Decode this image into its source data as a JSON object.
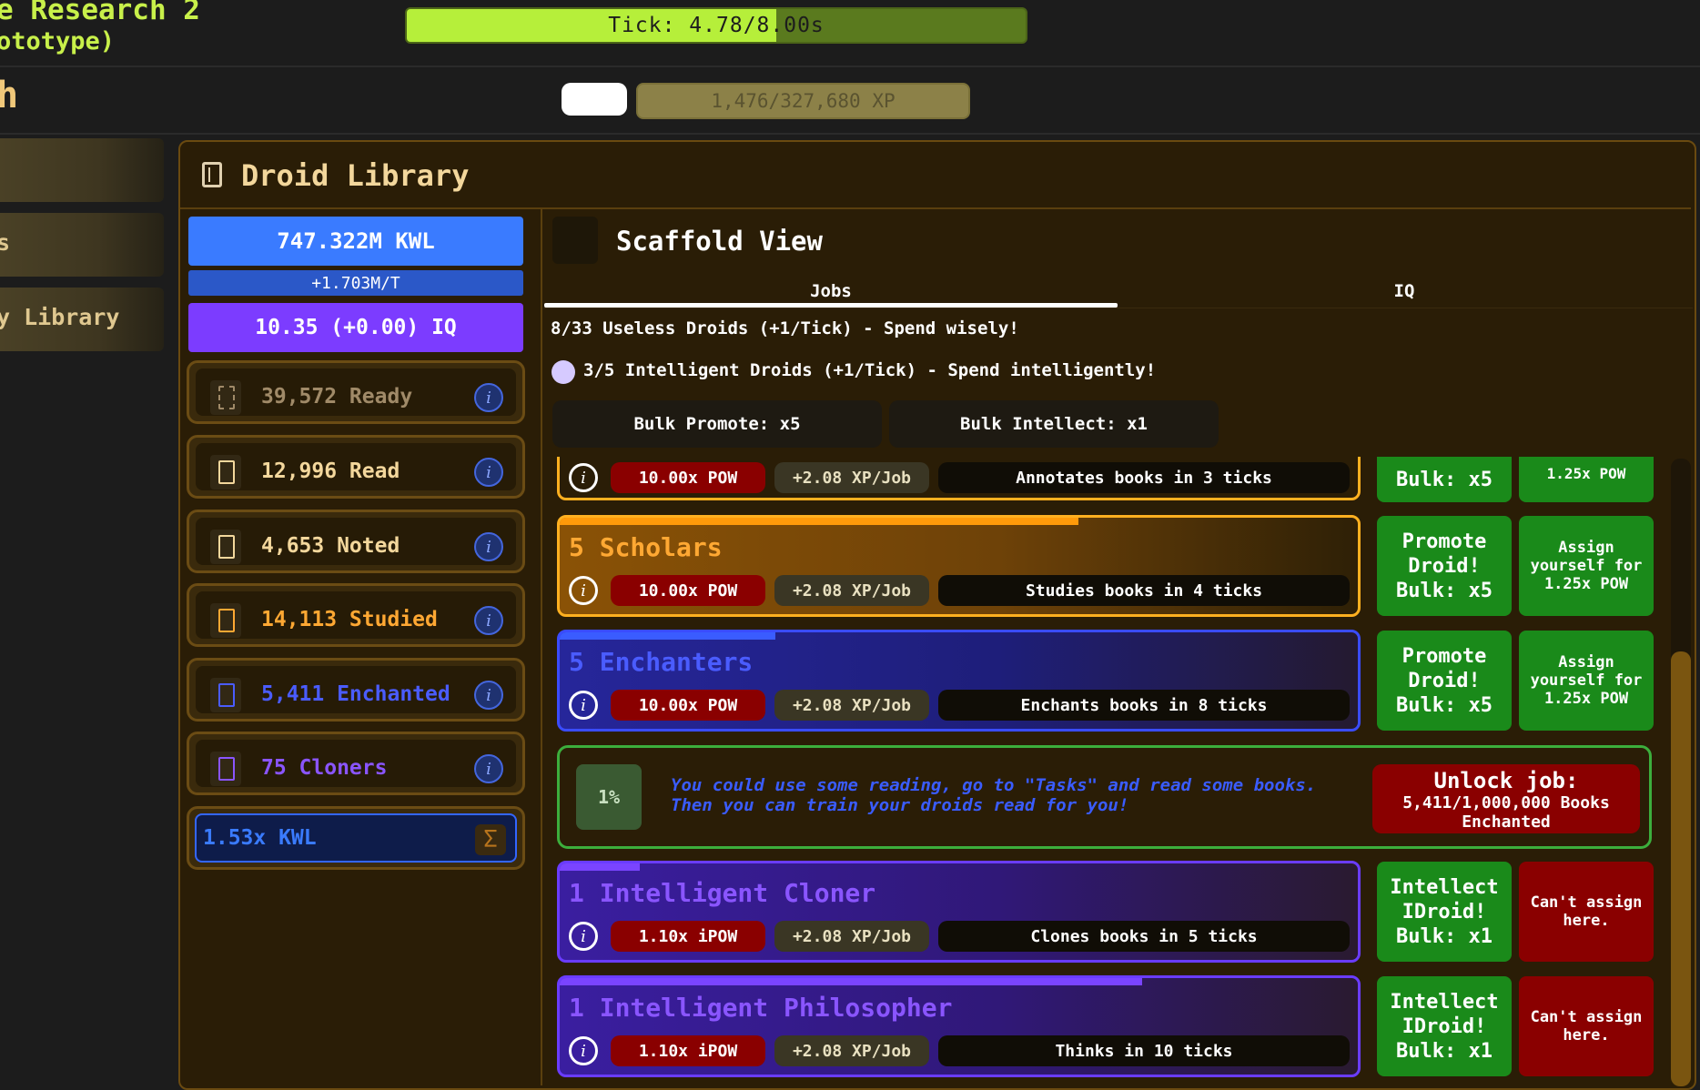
{
  "header": {
    "title": "e Research 2",
    "subtitle": "ototype)",
    "tick_text": "Tick: 4.78/8.00s",
    "tick_progress": 0.5975,
    "section_letter": "h",
    "xp_text": "1,476/327,680 XP"
  },
  "nav": {
    "items": [
      {
        "label": ""
      },
      {
        "label": "s"
      },
      {
        "label": "y Library"
      }
    ]
  },
  "library": {
    "title": "Droid Library",
    "kwl": "747.322M KWL",
    "kwl_rate": "+1.703M/T",
    "iq": "10.35 (+0.00) IQ",
    "resources": [
      {
        "label": "39,572 Ready",
        "color": "#a08a68",
        "icon": "dashed-page-icon"
      },
      {
        "label": "12,996 Read",
        "color": "#f3d79c",
        "icon": "checked-book-icon"
      },
      {
        "label": "4,653 Noted",
        "color": "#f3d79c",
        "icon": "notebook-icon"
      },
      {
        "label": "14,113 Studied",
        "color": "#ffa833",
        "icon": "magnify-book-icon"
      },
      {
        "label": "5,411 Enchanted",
        "color": "#4a5cff",
        "icon": "enchanted-book-icon"
      },
      {
        "label": "75 Cloners",
        "color": "#8a55ff",
        "icon": "tablet-icon"
      }
    ],
    "multiplier": "1.53x KWL"
  },
  "main": {
    "title": "Scaffold View",
    "tabs": [
      {
        "label": "Jobs"
      },
      {
        "label": "IQ"
      }
    ],
    "useless_line": "8/33 Useless Droids (+1/Tick) - Spend wisely!",
    "intelligent_line": "3/5 Intelligent Droids (+1/Tick) - Spend intelligently!",
    "bulk_promote": "Bulk Promote: x5",
    "bulk_intellect": "Bulk Intellect: x1",
    "jobs": [
      {
        "title": "",
        "pow": "10.00x POW",
        "xp": "+2.08 XP/Job",
        "desc": "Annotates books in 3 ticks",
        "btn1": "Bulk: x5",
        "btn2": "1.25x POW",
        "progress": 0
      },
      {
        "title": "5 Scholars",
        "pow": "10.00x POW",
        "xp": "+2.08 XP/Job",
        "desc": "Studies books in 4 ticks",
        "btn1": "Promote Droid! Bulk: x5",
        "btn2": "Assign yourself for 1.25x POW",
        "progress": 0.65
      },
      {
        "title": "5 Enchanters",
        "pow": "10.00x POW",
        "xp": "+2.08 XP/Job",
        "desc": "Enchants books in 8 ticks",
        "btn1": "Promote Droid! Bulk: x5",
        "btn2": "Assign yourself for 1.25x POW",
        "progress": 0.27
      },
      {
        "title": "1 Intelligent Cloner",
        "pow": "1.10x iPOW",
        "xp": "+2.08 XP/Job",
        "desc": "Clones books in 5 ticks",
        "btn1": "Intellect IDroid! Bulk: x1",
        "btn2": "Can't assign here.",
        "progress": 0.1
      },
      {
        "title": "1 Intelligent Philosopher",
        "pow": "1.10x iPOW",
        "xp": "+2.08 XP/Job",
        "desc": "Thinks in 10 ticks",
        "btn1": "Intellect IDroid! Bulk: x1",
        "btn2": "Can't assign here.",
        "progress": 0.73
      }
    ],
    "hint": {
      "percent": "1%",
      "text": "You could use some reading, go to \"Tasks\" and read some books. Then you can train your droids read for you!",
      "unlock_title": "Unlock job:",
      "unlock_sub": "5,411/1,000,000 Books Enchanted"
    }
  }
}
